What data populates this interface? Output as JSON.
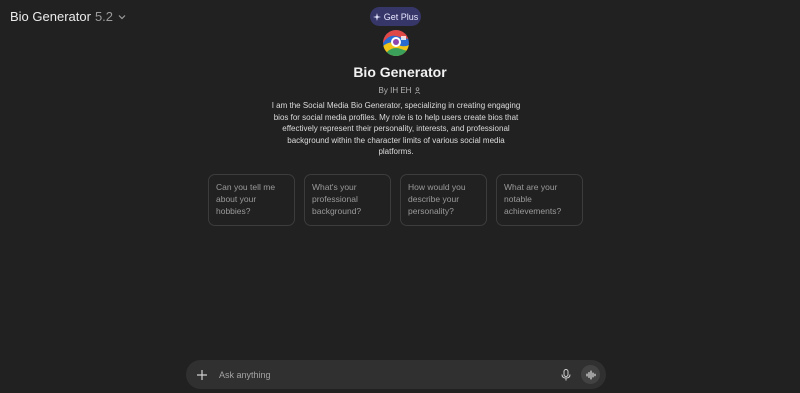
{
  "header": {
    "model_name": "Bio Generator",
    "model_version": "5.2",
    "get_plus_label": "Get Plus"
  },
  "gpt": {
    "title": "Bio Generator",
    "byline": "By IH EH",
    "description": "I am the Social Media Bio Generator, specializing in creating engaging bios for social media profiles. My role is to help users create bios that effectively represent their personality, interests, and professional background within the character limits of various social media platforms."
  },
  "starters": [
    {
      "label": "Can you tell me about your hobbies?"
    },
    {
      "label": "What's your professional background?"
    },
    {
      "label": "How would you describe your personality?"
    },
    {
      "label": "What are your notable achievements?"
    }
  ],
  "composer": {
    "placeholder": "Ask anything"
  },
  "colors": {
    "background": "#212121",
    "plus_button": "#373669",
    "composer": "#303030"
  },
  "icons": [
    "chevron-down-icon",
    "sparkle-icon",
    "person-icon",
    "plus-icon",
    "microphone-icon",
    "voice-wave-icon"
  ]
}
